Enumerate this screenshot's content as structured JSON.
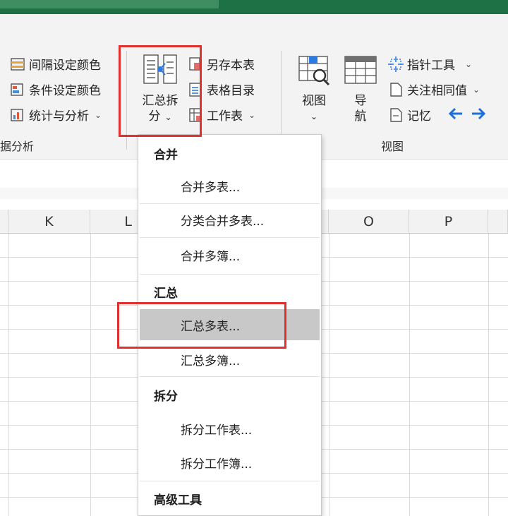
{
  "ribbon": {
    "left_group": {
      "items": [
        "间隔设定颜色",
        "条件设定颜色",
        "统计与分析"
      ],
      "label": "据分析"
    },
    "split_button": {
      "line1": "汇总拆",
      "line2": "分"
    },
    "middle_items": [
      "另存本表",
      "表格目录",
      "工作表"
    ],
    "view_group": {
      "view_button": "视图",
      "nav_button_line1": "导",
      "nav_button_line2": "航",
      "items": [
        "指针工具",
        "关注相同值",
        "记忆"
      ],
      "label": "视图"
    }
  },
  "columns": [
    "K",
    "L",
    "O",
    "P"
  ],
  "menu": {
    "sections": [
      {
        "header": "合并",
        "items": [
          "合并多表...",
          "分类合并多表...",
          "合并多簿..."
        ]
      },
      {
        "header": "汇总",
        "items": [
          "汇总多表...",
          "汇总多簿..."
        ]
      },
      {
        "header": "拆分",
        "items": [
          "拆分工作表...",
          "拆分工作簿..."
        ]
      },
      {
        "header": "高级工具",
        "items": []
      }
    ],
    "active_item": "汇总多表..."
  },
  "colors": {
    "accent": "#1e7145",
    "highlight": "#e0312f",
    "arrow": "#1e6fd9"
  }
}
